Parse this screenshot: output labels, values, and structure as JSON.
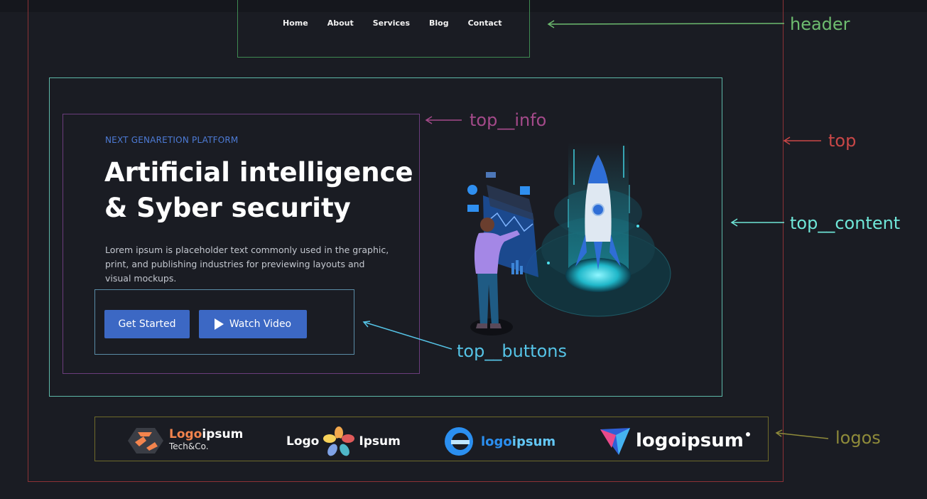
{
  "nav": {
    "items": [
      "Home",
      "About",
      "Services",
      "Blog",
      "Contact"
    ]
  },
  "hero": {
    "eyebrow": "NEXT GENARETION PLATFORM",
    "headline_line1": "Artificial intelligence",
    "headline_line2": "& Syber security",
    "description": "Lorem ipsum is placeholder text commonly used in the graphic, print, and publishing industries for previewing layouts and visual mockups.",
    "primary_button": "Get Started",
    "secondary_button": "Watch Video"
  },
  "annotations": {
    "header": "header",
    "top_info": "top__info",
    "top": "top",
    "top_content": "top__content",
    "top_buttons": "top__buttons",
    "logos": "logos"
  },
  "logos": {
    "logo1_main_a": "Logo",
    "logo1_main_b": "ipsum",
    "logo1_sub": "Tech&Co.",
    "logo2_left": "Logo",
    "logo2_right": "Ipsum",
    "logo3_a": "logo",
    "logo3_b": "ipsum",
    "logo4": "logoipsum"
  },
  "colors": {
    "background": "#1a1c23",
    "accent": "#3c68c4",
    "eyebrow": "#4d7bd6"
  }
}
